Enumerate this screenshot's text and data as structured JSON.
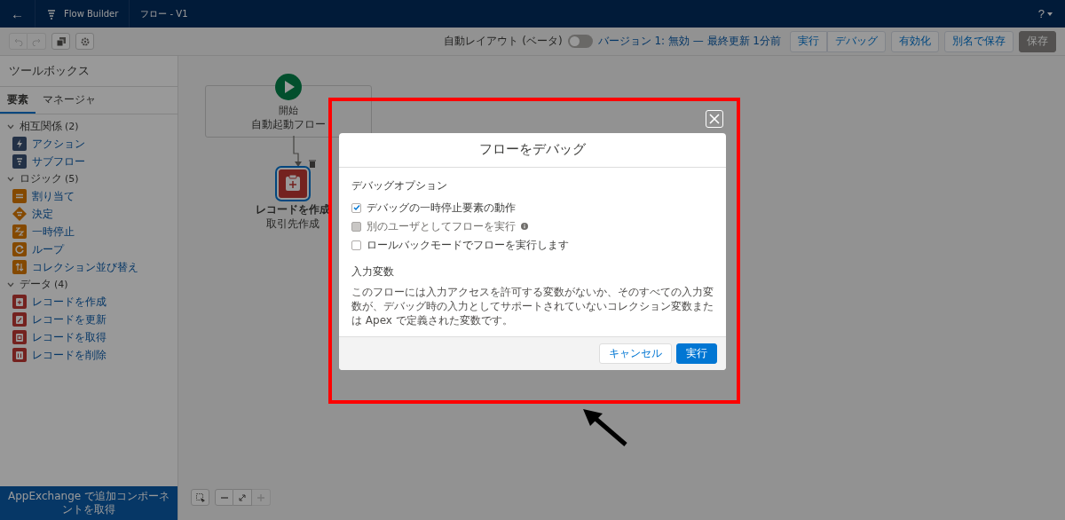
{
  "header": {
    "back": "←",
    "app_name": "Flow Builder",
    "flow_name": "フロー - V1",
    "help": "?"
  },
  "toolbar": {
    "auto_layout": {
      "label": "自動レイアウト (ベータ)",
      "on": false
    },
    "version": "バージョン 1: 無効 — 最終更新 1分前",
    "buttons": [
      {
        "label": "実行",
        "disabled": false,
        "group": true
      },
      {
        "label": "デバッグ",
        "disabled": false,
        "group": true
      },
      {
        "label": "有効化",
        "disabled": false,
        "group": false
      },
      {
        "label": "別名で保存",
        "disabled": false,
        "group": false
      },
      {
        "label": "保存",
        "disabled": true,
        "group": false
      }
    ]
  },
  "sidebar": {
    "title": "ツールボックス",
    "tabs": [
      {
        "label": "要素",
        "selected": true
      },
      {
        "label": "マネージャ",
        "selected": false
      }
    ],
    "groups": [
      {
        "label": "相互関係",
        "count": "(2)",
        "expanded": true,
        "items": [
          {
            "label": "アクション",
            "kind": "action"
          },
          {
            "label": "サブフロー",
            "kind": "subflow"
          }
        ]
      },
      {
        "label": "ロジック",
        "count": "(5)",
        "expanded": true,
        "items": [
          {
            "label": "割り当て",
            "kind": "assignment"
          },
          {
            "label": "決定",
            "kind": "decision"
          },
          {
            "label": "一時停止",
            "kind": "pause"
          },
          {
            "label": "ループ",
            "kind": "loop"
          },
          {
            "label": "コレクション並び替え",
            "kind": "sort"
          }
        ]
      },
      {
        "label": "データ",
        "count": "(4)",
        "expanded": true,
        "items": [
          {
            "label": "レコードを作成",
            "kind": "create"
          },
          {
            "label": "レコードを更新",
            "kind": "update"
          },
          {
            "label": "レコードを取得",
            "kind": "get"
          },
          {
            "label": "レコードを削除",
            "kind": "delete"
          }
        ]
      }
    ],
    "footer": "AppExchange で追加コンポーネントを取得"
  },
  "canvas": {
    "start": {
      "title": "開始",
      "subtitle": "自動起動フロー"
    },
    "node": {
      "title": "レコードを作成",
      "subtitle": "取引先作成",
      "selected": true
    }
  },
  "modal": {
    "title": "フローをデバッグ",
    "section_title": "デバッグオプション",
    "options": [
      {
        "label": "デバッグの一時停止要素の動作",
        "checked": true,
        "disabled": false,
        "info": false
      },
      {
        "label": "別のユーザとしてフローを実行",
        "checked": false,
        "disabled": true,
        "info": true
      },
      {
        "label": "ロールバックモードでフローを実行します",
        "checked": false,
        "disabled": false,
        "info": false
      }
    ],
    "inputs_title": "入力変数",
    "inputs_text": "このフローには入力アクセスを許可する変数がないか、そのすべての入力変数が、デバッグ時の入力としてサポートされていないコレクション変数または Apex で定義された変数です。",
    "cancel": "キャンセル",
    "run": "実行"
  }
}
